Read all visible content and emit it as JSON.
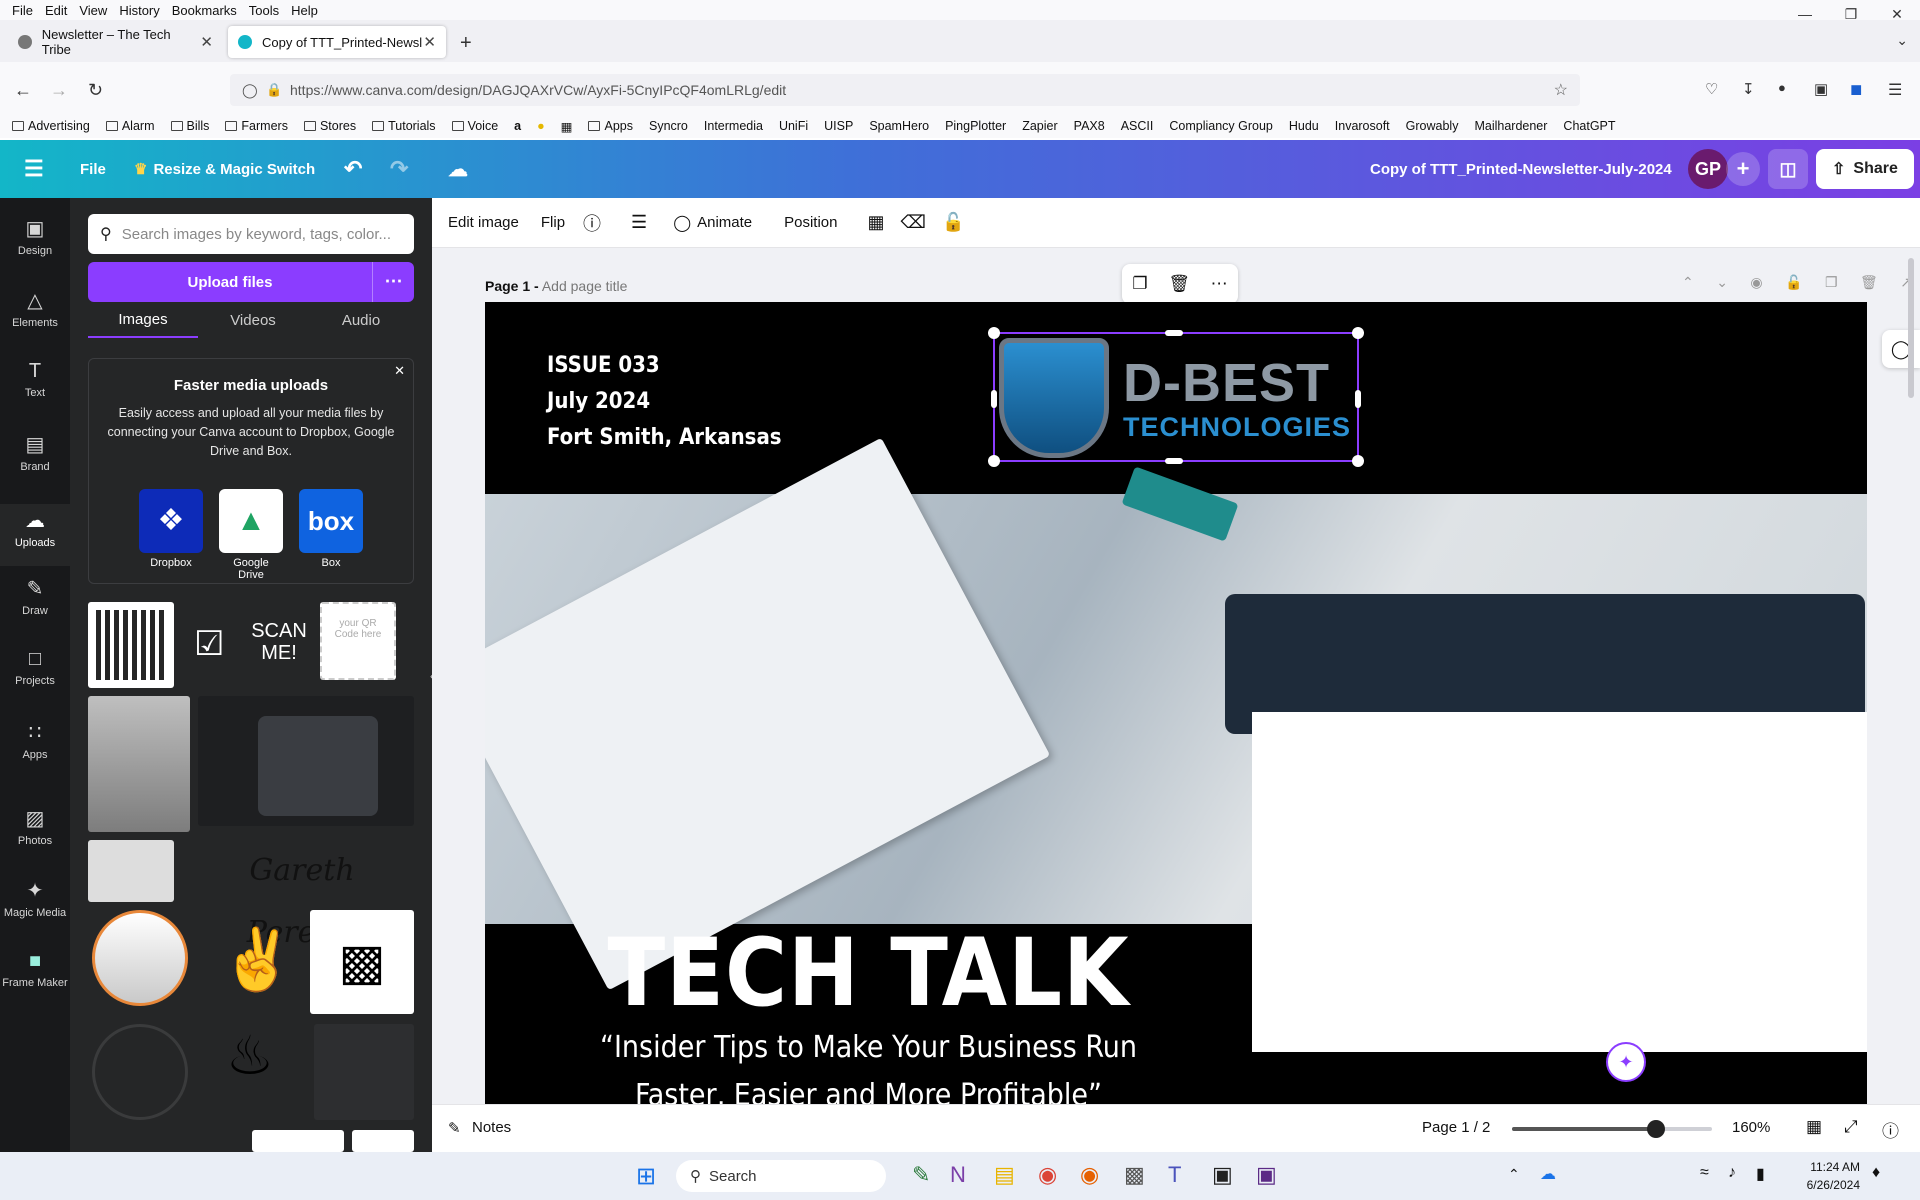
{
  "browser": {
    "menu": [
      "File",
      "Edit",
      "View",
      "History",
      "Bookmarks",
      "Tools",
      "Help"
    ],
    "tabs": [
      {
        "label": "Newsletter – The Tech Tribe"
      },
      {
        "label": "Copy of TTT_Printed-Newslette"
      }
    ],
    "url": "https://www.canva.com/design/DAGJQAXrVCw/AyxFi-5CnyIPcQF4omLRLg/edit",
    "bookmarks": [
      "Advertising",
      "Alarm",
      "Bills",
      "Farmers",
      "Stores",
      "Tutorials",
      "Voice",
      "Apps",
      "Syncro",
      "Intermedia",
      "UniFi",
      "UISP",
      "SpamHero",
      "PingPlotter",
      "Zapier",
      "PAX8",
      "ASCII",
      "Compliancy Group",
      "Hudu",
      "Invarosoft",
      "Growably",
      "Mailhardener",
      "ChatGPT"
    ]
  },
  "canva": {
    "file": "File",
    "resize": "Resize & Magic Switch",
    "doc_title": "Copy of  TTT_Printed-Newsletter-July-2024",
    "avatar": "GP",
    "share": "Share",
    "rail": [
      "Design",
      "Elements",
      "Text",
      "Brand",
      "Uploads",
      "Draw",
      "Projects",
      "Apps",
      "Photos",
      "Magic Media",
      "Frame Maker"
    ],
    "panel": {
      "search_placeholder": "Search images by keyword, tags, color...",
      "upload": "Upload files",
      "tabs": [
        "Images",
        "Videos",
        "Audio"
      ],
      "faster_title": "Faster media uploads",
      "faster_text": "Easily access and upload all your media files by connecting your Canva account to Dropbox, Google Drive and Box.",
      "services": [
        "Dropbox",
        "Google Drive",
        "Box"
      ],
      "scan_text": "SCAN ME!",
      "qr_placeholder": "your QR Code here",
      "signature": "Gareth Pereira"
    },
    "editbar": [
      "Edit image",
      "Flip",
      "Animate",
      "Position"
    ],
    "page_label": "Page 1 -",
    "page_title_placeholder": "Add page title",
    "newsletter": {
      "issue": "ISSUE 033",
      "date": "July 2024",
      "location": "Fort Smith, Arkansas",
      "logo_main": "D-BEST",
      "logo_sub": "TECHNOLOGIES",
      "headline": "TECH TALK",
      "tagline_1": "“Insider Tips to Make Your Business Run",
      "tagline_2": "Faster, Easier and More Profitable”"
    },
    "bottom": {
      "notes": "Notes",
      "page_count": "Page 1 / 2",
      "zoom": "160%",
      "zoom_fraction": 0.72
    }
  },
  "taskbar": {
    "search": "Search",
    "time": "11:24 AM",
    "date": "6/26/2024"
  },
  "colors": {
    "accent": "#8b3dff",
    "teal": "#13b6c8",
    "logo_blue": "#2b8fd0"
  }
}
